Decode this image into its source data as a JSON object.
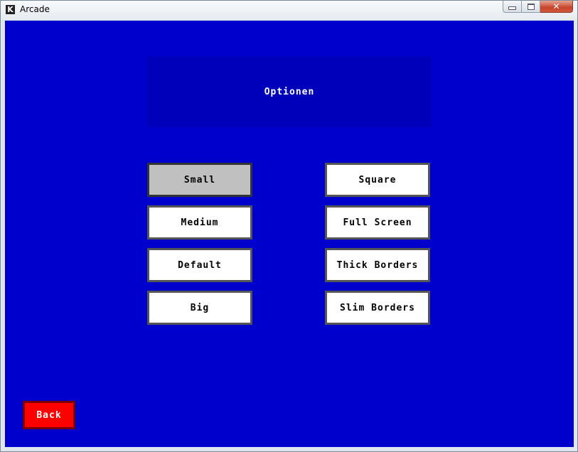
{
  "window": {
    "title": "Arcade",
    "icon_glyph": "K",
    "icon_name": "app-icon",
    "close_glyph": "✕"
  },
  "screen": {
    "background_color": "#0000cc",
    "title": "Optionen"
  },
  "size_options": [
    {
      "label": "Small",
      "selected": true
    },
    {
      "label": "Medium",
      "selected": false
    },
    {
      "label": "Default",
      "selected": false
    },
    {
      "label": "Big",
      "selected": false
    }
  ],
  "display_options": [
    {
      "label": "Square",
      "selected": false
    },
    {
      "label": "Full Screen",
      "selected": false
    },
    {
      "label": "Thick Borders",
      "selected": false
    },
    {
      "label": "Slim Borders",
      "selected": false
    }
  ],
  "back_button": {
    "label": "Back",
    "color": "#ff0000"
  }
}
